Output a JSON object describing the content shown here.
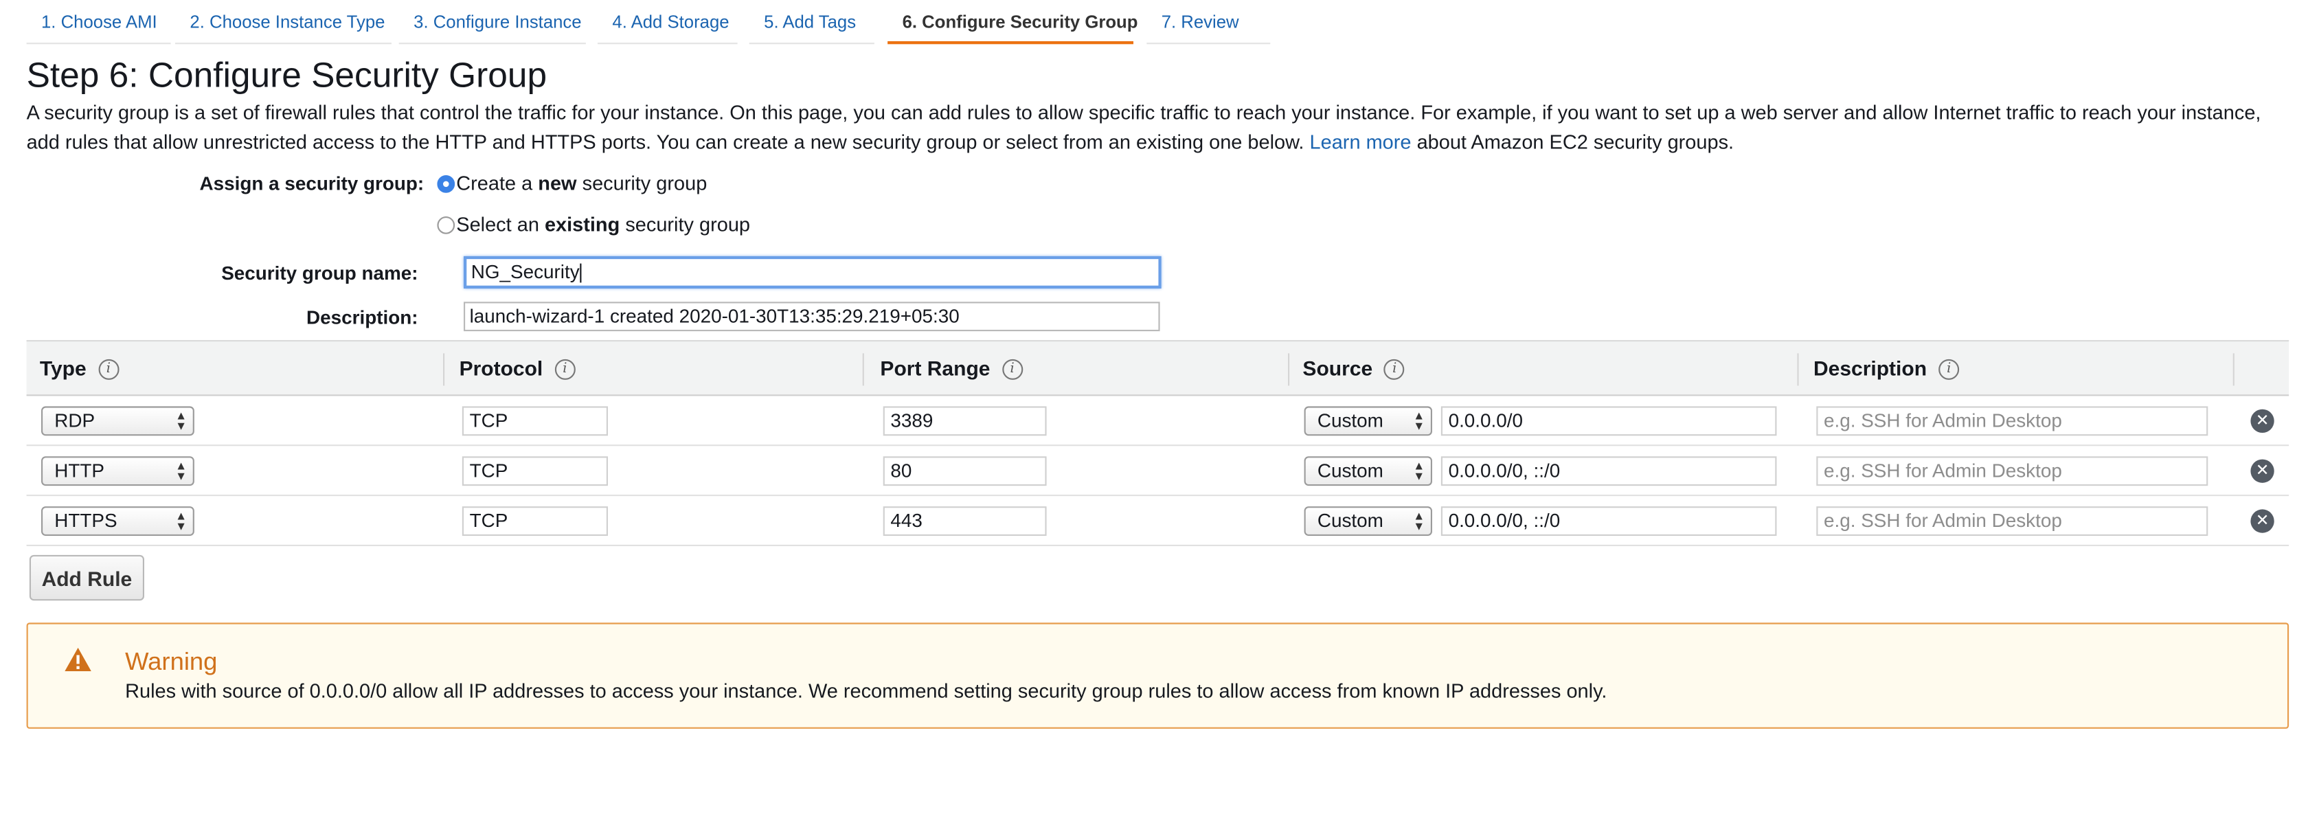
{
  "tabs": [
    {
      "label": "1. Choose AMI"
    },
    {
      "label": "2. Choose Instance Type"
    },
    {
      "label": "3. Configure Instance"
    },
    {
      "label": "4. Add Storage"
    },
    {
      "label": "5. Add Tags"
    },
    {
      "label": "6. Configure Security Group",
      "active": true
    },
    {
      "label": "7. Review"
    }
  ],
  "page": {
    "title": "Step 6: Configure Security Group",
    "intro": "A security group is a set of firewall rules that control the traffic for your instance. On this page, you can add rules to allow specific traffic to reach your instance. For example, if you want to set up a web server and allow Internet traffic to reach your instance, add rules that allow unrestricted access to the HTTP and HTTPS ports. You can create a new security group or select from an existing one below.",
    "learn_more": "Learn more",
    "intro_tail": "about Amazon EC2 security groups."
  },
  "form": {
    "assign_label": "Assign a security group:",
    "option_new": {
      "prefix": "Create a ",
      "bold": "new",
      "suffix": " security group",
      "selected": true
    },
    "option_existing": {
      "prefix": "Select an ",
      "bold": "existing",
      "suffix": " security group",
      "selected": false
    },
    "name_label": "Security group name:",
    "name_value": "NG_Security",
    "desc_label": "Description:",
    "desc_value": "launch-wizard-1 created 2020-01-30T13:35:29.219+05:30"
  },
  "table": {
    "headers": {
      "type": "Type",
      "protocol": "Protocol",
      "port_range": "Port Range",
      "source": "Source",
      "description": "Description"
    },
    "info_glyph": "i",
    "rows": [
      {
        "type": "RDP",
        "protocol": "TCP",
        "port": "3389",
        "source_type": "Custom",
        "source": "0.0.0.0/0",
        "description_placeholder": "e.g. SSH for Admin Desktop"
      },
      {
        "type": "HTTP",
        "protocol": "TCP",
        "port": "80",
        "source_type": "Custom",
        "source": "0.0.0.0/0, ::/0",
        "description_placeholder": "e.g. SSH for Admin Desktop"
      },
      {
        "type": "HTTPS",
        "protocol": "TCP",
        "port": "443",
        "source_type": "Custom",
        "source": "0.0.0.0/0, ::/0",
        "description_placeholder": "e.g. SSH for Admin Desktop"
      }
    ],
    "add_rule": "Add Rule"
  },
  "warning": {
    "title": "Warning",
    "text": "Rules with source of 0.0.0.0/0 allow all IP addresses to access your instance. We recommend setting security group rules to allow access from known IP addresses only."
  },
  "icons": {
    "info": "info-icon",
    "remove": "remove-icon",
    "warning": "warning-triangle-icon"
  },
  "colors": {
    "link": "#1b64b0",
    "active_tab_underline": "#ec7211",
    "warning_border": "#e79c4c",
    "warning_title": "#d0711b",
    "warning_bg": "#fffbee",
    "radio_selected": "#3b82e6"
  }
}
